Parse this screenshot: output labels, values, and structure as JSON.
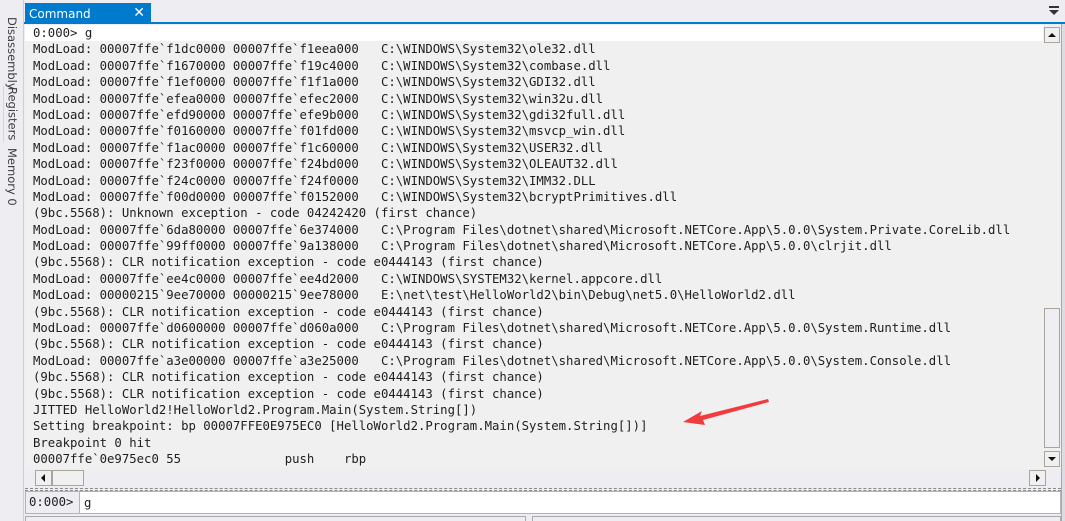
{
  "side_tabs": [
    "Disassembly",
    "Registers",
    "Memory 0"
  ],
  "tab": {
    "label": "Command",
    "close_icon": "close-icon"
  },
  "output_lines": [
    "0:000> g",
    "ModLoad: 00007ffe`f1dc0000 00007ffe`f1eea000   C:\\WINDOWS\\System32\\ole32.dll",
    "ModLoad: 00007ffe`f1670000 00007ffe`f19c4000   C:\\WINDOWS\\System32\\combase.dll",
    "ModLoad: 00007ffe`f1ef0000 00007ffe`f1f1a000   C:\\WINDOWS\\System32\\GDI32.dll",
    "ModLoad: 00007ffe`efea0000 00007ffe`efec2000   C:\\WINDOWS\\System32\\win32u.dll",
    "ModLoad: 00007ffe`efd90000 00007ffe`efe9b000   C:\\WINDOWS\\System32\\gdi32full.dll",
    "ModLoad: 00007ffe`f0160000 00007ffe`f01fd000   C:\\WINDOWS\\System32\\msvcp_win.dll",
    "ModLoad: 00007ffe`f1ac0000 00007ffe`f1c60000   C:\\WINDOWS\\System32\\USER32.dll",
    "ModLoad: 00007ffe`f23f0000 00007ffe`f24bd000   C:\\WINDOWS\\System32\\OLEAUT32.dll",
    "ModLoad: 00007ffe`f24c0000 00007ffe`f24f0000   C:\\WINDOWS\\System32\\IMM32.DLL",
    "ModLoad: 00007ffe`f00d0000 00007ffe`f0152000   C:\\WINDOWS\\System32\\bcryptPrimitives.dll",
    "(9bc.5568): Unknown exception - code 04242420 (first chance)",
    "ModLoad: 00007ffe`6da80000 00007ffe`6e374000   C:\\Program Files\\dotnet\\shared\\Microsoft.NETCore.App\\5.0.0\\System.Private.CoreLib.dll",
    "ModLoad: 00007ffe`99ff0000 00007ffe`9a138000   C:\\Program Files\\dotnet\\shared\\Microsoft.NETCore.App\\5.0.0\\clrjit.dll",
    "(9bc.5568): CLR notification exception - code e0444143 (first chance)",
    "ModLoad: 00007ffe`ee4c0000 00007ffe`ee4d2000   C:\\WINDOWS\\SYSTEM32\\kernel.appcore.dll",
    "ModLoad: 00000215`9ee70000 00000215`9ee78000   E:\\net\\test\\HelloWorld2\\bin\\Debug\\net5.0\\HelloWorld2.dll",
    "(9bc.5568): CLR notification exception - code e0444143 (first chance)",
    "ModLoad: 00007ffe`d0600000 00007ffe`d060a000   C:\\Program Files\\dotnet\\shared\\Microsoft.NETCore.App\\5.0.0\\System.Runtime.dll",
    "(9bc.5568): CLR notification exception - code e0444143 (first chance)",
    "ModLoad: 00007ffe`a3e00000 00007ffe`a3e25000   C:\\Program Files\\dotnet\\shared\\Microsoft.NETCore.App\\5.0.0\\System.Console.dll",
    "(9bc.5568): CLR notification exception - code e0444143 (first chance)",
    "(9bc.5568): CLR notification exception - code e0444143 (first chance)",
    "JITTED HelloWorld2!HelloWorld2.Program.Main(System.String[])",
    "Setting breakpoint: bp 00007FFE0E975EC0 [HelloWorld2.Program.Main(System.String[])]",
    "Breakpoint 0 hit",
    "00007ffe`0e975ec0 55              push    rbp"
  ],
  "command": {
    "prompt": "0:000>",
    "value": "g"
  },
  "annotation": {
    "type": "arrow",
    "color": "#f03c3c",
    "points_to_line": 25
  }
}
